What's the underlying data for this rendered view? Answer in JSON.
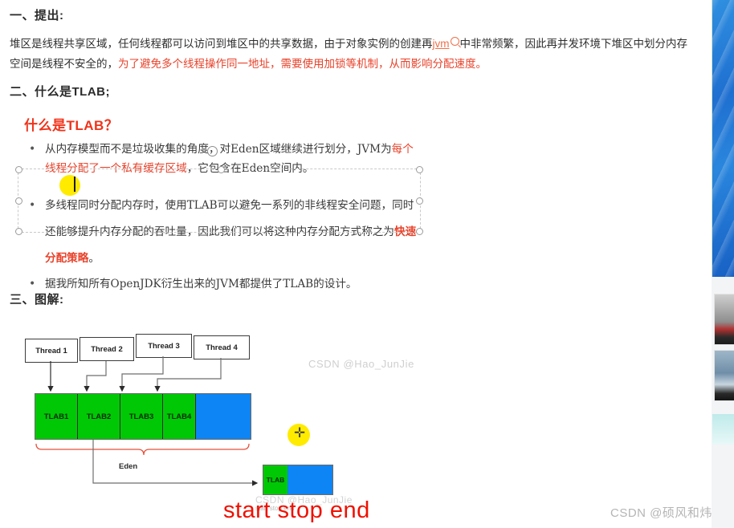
{
  "sections": {
    "h1": "一、提出:",
    "h2": "二、什么是TLAB;",
    "h3": "三、图解:"
  },
  "paragraph1": {
    "part1": "堆区是线程共享区域，任何线程都可以访问到堆区中的共享数据，由于对象实例的创建再",
    "link": "jvm",
    "part2": "中非常频繁，因此再并发环境下堆区中划分内存空间是线程不安全的，",
    "red": "为了避免多个线程操作同一地址，需要使用加锁等机制，从而影响分配速度。"
  },
  "slide": {
    "title": "什么是TLAB？",
    "bullets": [
      {
        "seg1": "从内存模型而不是垃圾收集的角度，对Eden区域继续进行划分，JVM为",
        "red": "每个线程分配了一个私有缓存区域",
        "seg2": "，它包含在Eden空间内。"
      },
      {
        "seg1": "多线程同时分配内存时，使用TLAB可以避免一系列的非线程安全问题，同时还能够提升内存分配的吞吐量，因此我们可以将这种内存分配方式称之为",
        "redbold": "快速分配策略",
        "seg2": "。"
      },
      {
        "seg1": "据我所知所有OpenJDK衍生出来的JVM都提供了TLAB的设计。"
      }
    ],
    "watermark": "CSDN @Hao_JunJie"
  },
  "diagram": {
    "threads": [
      "Thread 1",
      "Thread 2",
      "Thread 3",
      "Thread 4"
    ],
    "tlab_cells": [
      "TLAB1",
      "TLAB2",
      "TLAB3",
      "TLAB4"
    ],
    "eden_label": "Eden",
    "detail_tlab_label": "TLAB",
    "annotation": "start  stop  end",
    "watermark": "CSDN @Hao_JunJie",
    "watermark_small": "start         stop          end"
  },
  "footer": {
    "watermark": "CSDN @硕风和炜"
  },
  "colors": {
    "tlab_green": "#00c805",
    "free_blue": "#0d85f5",
    "accent_red": "#e8422a",
    "title_red": "#f0331a",
    "link_orange": "#f0704a",
    "highlight_yellow": "#ffeb00"
  },
  "rail": {
    "watermark": "炜"
  }
}
